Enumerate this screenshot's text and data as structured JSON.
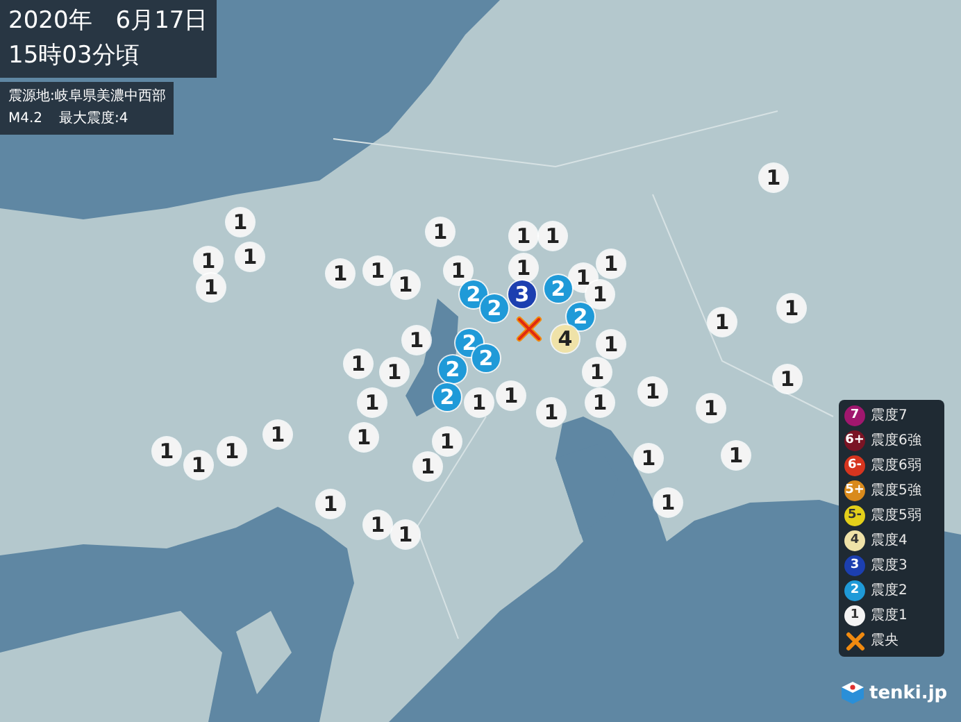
{
  "header": {
    "date": "2020年　6月17日",
    "time": "15時03分頃",
    "epicenter": "震源地:岐阜県美濃中西部",
    "magnitude": "M4.2",
    "max_intensity": "最大震度:4"
  },
  "markers": [
    {
      "label": "1",
      "color": "#f4f4f4"
    },
    {
      "label": "1",
      "color": "#f4f4f4"
    },
    {
      "label": "1",
      "color": "#f4f4f4"
    },
    {
      "label": "1",
      "color": "#f4f4f4"
    },
    {
      "label": "1",
      "color": "#f4f4f4"
    },
    {
      "label": "1",
      "color": "#f4f4f4"
    },
    {
      "label": "1",
      "color": "#f4f4f4"
    },
    {
      "label": "1",
      "color": "#f4f4f4"
    },
    {
      "label": "1",
      "color": "#f4f4f4"
    },
    {
      "label": "1",
      "color": "#f4f4f4"
    },
    {
      "label": "1",
      "color": "#f4f4f4"
    },
    {
      "label": "1",
      "color": "#f4f4f4"
    },
    {
      "label": "1",
      "color": "#f4f4f4"
    },
    {
      "label": "1",
      "color": "#f4f4f4"
    },
    {
      "label": "1",
      "color": "#f4f4f4"
    },
    {
      "label": "2",
      "color": "#1f9ad8"
    },
    {
      "label": "2",
      "color": "#1f9ad8"
    },
    {
      "label": "3",
      "color": "#1c3fb0"
    },
    {
      "label": "2",
      "color": "#1f9ad8"
    },
    {
      "label": "2",
      "color": "#1f9ad8"
    },
    {
      "label": "1",
      "color": "#f4f4f4"
    },
    {
      "label": "1",
      "color": "#f4f4f4"
    },
    {
      "label": "4",
      "color": "#efe2a8"
    },
    {
      "label": "1",
      "color": "#f4f4f4"
    },
    {
      "label": "1",
      "color": "#f4f4f4"
    },
    {
      "label": "2",
      "color": "#1f9ad8"
    },
    {
      "label": "1",
      "color": "#f4f4f4"
    },
    {
      "label": "2",
      "color": "#1f9ad8"
    },
    {
      "label": "1",
      "color": "#f4f4f4"
    },
    {
      "label": "1",
      "color": "#f4f4f4"
    },
    {
      "label": "2",
      "color": "#1f9ad8"
    },
    {
      "label": "1",
      "color": "#f4f4f4"
    },
    {
      "label": "1",
      "color": "#f4f4f4"
    },
    {
      "label": "2",
      "color": "#1f9ad8"
    },
    {
      "label": "1",
      "color": "#f4f4f4"
    },
    {
      "label": "1",
      "color": "#f4f4f4"
    },
    {
      "label": "1",
      "color": "#f4f4f4"
    },
    {
      "label": "1",
      "color": "#f4f4f4"
    },
    {
      "label": "1",
      "color": "#f4f4f4"
    },
    {
      "label": "1",
      "color": "#f4f4f4"
    },
    {
      "label": "1",
      "color": "#f4f4f4"
    },
    {
      "label": "1",
      "color": "#f4f4f4"
    },
    {
      "label": "1",
      "color": "#f4f4f4"
    },
    {
      "label": "1",
      "color": "#f4f4f4"
    },
    {
      "label": "1",
      "color": "#f4f4f4"
    },
    {
      "label": "1",
      "color": "#f4f4f4"
    },
    {
      "label": "1",
      "color": "#f4f4f4"
    },
    {
      "label": "1",
      "color": "#f4f4f4"
    },
    {
      "label": "1",
      "color": "#f4f4f4"
    },
    {
      "label": "1",
      "color": "#f4f4f4"
    },
    {
      "label": "1",
      "color": "#f4f4f4"
    },
    {
      "label": "1",
      "color": "#f4f4f4"
    },
    {
      "label": "1",
      "color": "#f4f4f4"
    },
    {
      "label": "1",
      "color": "#f4f4f4"
    }
  ],
  "legend": [
    {
      "kind": "badge",
      "badge": "7",
      "label": "震度7",
      "color": "#a0176e"
    },
    {
      "kind": "badge",
      "badge": "6+",
      "label": "震度6強",
      "color": "#7a1424"
    },
    {
      "kind": "badge",
      "badge": "6-",
      "label": "震度6弱",
      "color": "#d6351f"
    },
    {
      "kind": "badge",
      "badge": "5+",
      "label": "震度5強",
      "color": "#d98a1c"
    },
    {
      "kind": "badge",
      "badge": "5-",
      "label": "震度5弱",
      "color": "#e3cf1a"
    },
    {
      "kind": "badge",
      "badge": "4",
      "label": "震度4",
      "color": "#efe2a8"
    },
    {
      "kind": "badge",
      "badge": "3",
      "label": "震度3",
      "color": "#1c3fb0"
    },
    {
      "kind": "badge",
      "badge": "2",
      "label": "震度2",
      "color": "#1f9ad8"
    },
    {
      "kind": "badge",
      "badge": "1",
      "label": "震度1",
      "color": "#f4f4f4"
    },
    {
      "kind": "cross",
      "label": "震央"
    }
  ],
  "brand": "tenki.jp"
}
